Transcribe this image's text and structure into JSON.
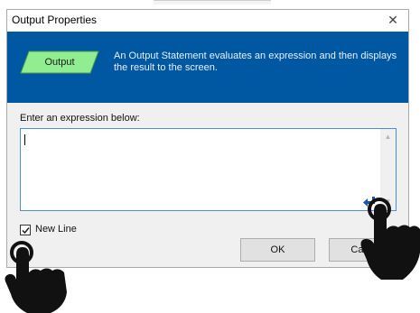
{
  "window": {
    "title": "Output Properties",
    "close_glyph": "✕"
  },
  "banner": {
    "shape_label": "Output",
    "description": "An Output Statement evaluates an expression and then displays the result to the screen."
  },
  "form": {
    "prompt": "Enter an expression below:",
    "expression_value": "",
    "new_line_label": "New Line",
    "new_line_checked": true
  },
  "buttons": {
    "ok_label": "OK",
    "cancel_label": "Cancel"
  },
  "icons": {
    "close": "close-icon",
    "enter": "enter-arrow-icon",
    "check": "checkmark-icon",
    "hand": "pointing-hand-icon"
  },
  "colors": {
    "banner_bg": "#0058a3",
    "shape_fill": "#90ee90",
    "enter_icon": "#1a56a8",
    "input_border": "#4a90d9"
  }
}
